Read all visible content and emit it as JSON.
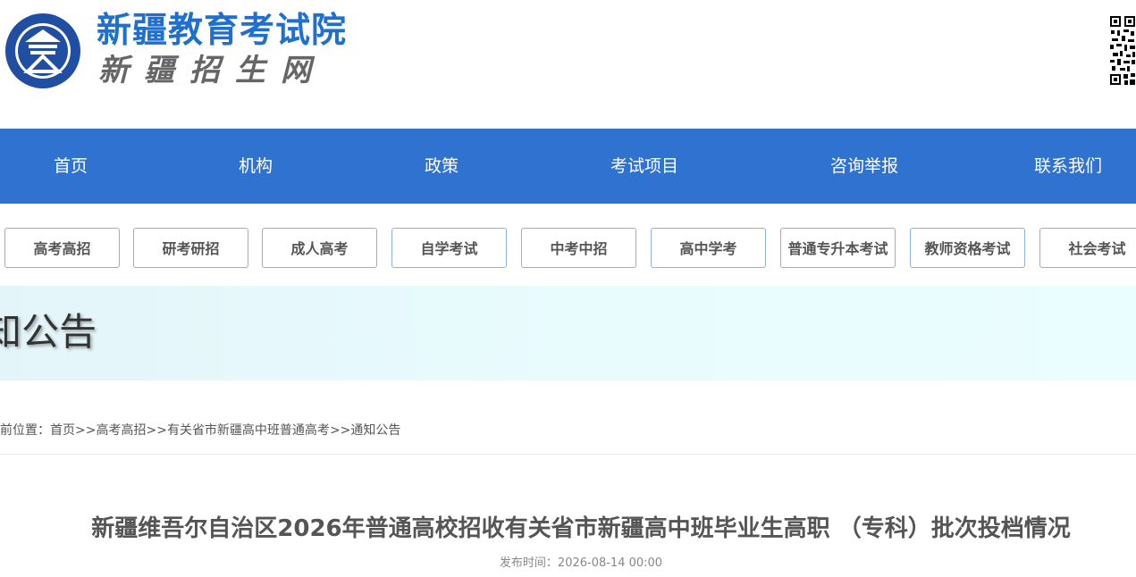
{
  "header": {
    "title": "新疆教育考试院",
    "subtitle": "新疆招生网",
    "emblem_text": "新疆教育考试院",
    "brand_color": "#1f6fd1"
  },
  "nav": {
    "background": "#3072cf",
    "items": [
      "首页",
      "机构",
      "政策",
      "考试项目",
      "咨询举报",
      "联系我们"
    ]
  },
  "subnav": {
    "items": [
      "高考高招",
      "研考研招",
      "成人高考",
      "自学考试",
      "中考中招",
      "高中学考",
      "普通专升本考试",
      "教师资格考试",
      "社会考试"
    ]
  },
  "banner": {
    "text": "知公告"
  },
  "breadcrumb": {
    "prefix": "前位置：",
    "links": [
      "首页",
      "高考高招",
      "有关省市新疆高中班普通高考",
      "通知公告"
    ],
    "separator": ">>"
  },
  "article": {
    "title": "新疆维吾尔自治区2026年普通高校招收有关省市新疆高中班毕业生高职 （专科）批次投档情况",
    "publish_label": "发布时间：",
    "publish_time": "2026-08-14 00:00"
  }
}
